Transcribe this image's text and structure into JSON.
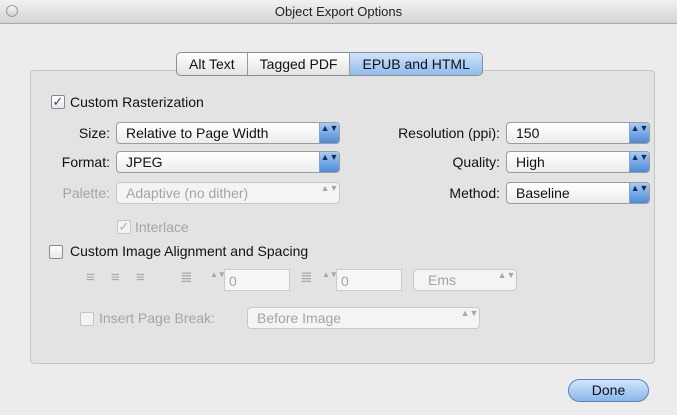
{
  "window": {
    "title": "Object Export Options"
  },
  "tabs": [
    {
      "label": "Alt Text",
      "active": false
    },
    {
      "label": "Tagged PDF",
      "active": false
    },
    {
      "label": "EPUB and HTML",
      "active": true
    }
  ],
  "rasterization": {
    "checkbox_label": "Custom Rasterization",
    "checked": true,
    "size": {
      "label": "Size:",
      "value": "Relative to Page Width"
    },
    "format": {
      "label": "Format:",
      "value": "JPEG"
    },
    "palette": {
      "label": "Palette:",
      "value": "Adaptive (no dither)",
      "enabled": false
    },
    "interlace": {
      "label": "Interlace",
      "checked": true,
      "enabled": false
    },
    "resolution": {
      "label": "Resolution (ppi):",
      "value": "150"
    },
    "quality": {
      "label": "Quality:",
      "value": "High"
    },
    "method": {
      "label": "Method:",
      "value": "Baseline"
    }
  },
  "alignment": {
    "checkbox_label": "Custom Image Alignment and Spacing",
    "checked": false,
    "space_before": "0",
    "space_after": "0",
    "units": "Ems",
    "page_break": {
      "label": "Insert Page Break:",
      "checked": false,
      "value": "Before Image"
    }
  },
  "glyphs": {
    "check": "✓",
    "updown": "▲▼"
  },
  "footer": {
    "done_label": "Done"
  },
  "colors": {
    "accent": "#8fbbee",
    "disabled_text": "#a4a4a4"
  }
}
